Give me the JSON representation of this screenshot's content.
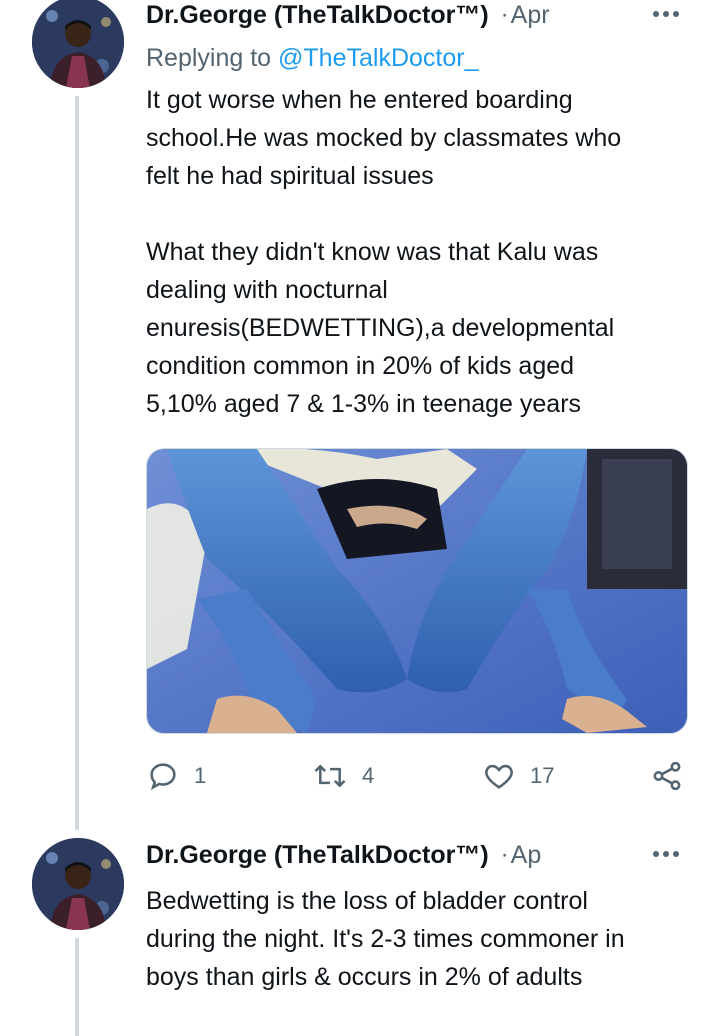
{
  "colors": {
    "accent": "#1d9bf0",
    "muted": "#536471",
    "thread_line": "#cfd9de"
  },
  "tweets": [
    {
      "author_name": "Dr.George (TheTalkDoctor™)",
      "separator": "·",
      "timestamp": "Apr",
      "replying_prefix": "Replying to",
      "replying_handle": "@TheTalkDoctor_",
      "lines": [
        "It got worse when he entered boarding",
        "school.He was mocked by classmates who",
        "felt he had spiritual issues",
        "",
        "What they didn't know was that Kalu was",
        "dealing with nocturnal",
        "enuresis(BEDWETTING),a developmental",
        "condition common in 20% of kids aged",
        "5,10% aged 7 & 1-3% in teenage years"
      ],
      "actions": {
        "reply_icon": "reply-icon",
        "reply_count": "1",
        "retweet_icon": "retweet-icon",
        "retweet_count": "4",
        "like_icon": "heart-icon",
        "like_count": "17",
        "share_icon": "share-icon"
      }
    },
    {
      "author_name": "Dr.George (TheTalkDoctor™)",
      "separator": "·",
      "timestamp": "Ap",
      "lines": [
        "Bedwetting is the loss of bladder control",
        "during the night. It's 2-3 times commoner in",
        "boys than girls &  occurs in 2% of adults"
      ]
    }
  ]
}
